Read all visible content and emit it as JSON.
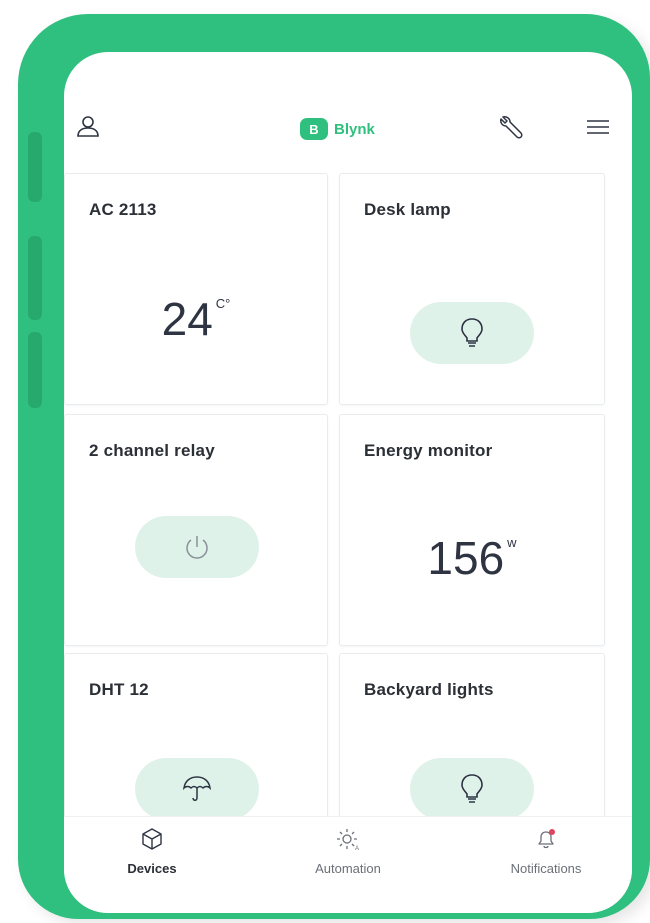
{
  "header": {
    "brand_letter": "B",
    "brand_name": "Blynk",
    "icons": {
      "profile": "user-icon",
      "settings": "wrench-icon",
      "menu": "hamburger-menu-icon"
    }
  },
  "devices": [
    {
      "title": "AC 2113",
      "value": "24",
      "unit": "C°"
    },
    {
      "title": "Desk lamp",
      "icon": "lightbulb-icon"
    },
    {
      "title": "2 channel relay",
      "icon": "power-icon"
    },
    {
      "title": "Energy monitor",
      "value": "156",
      "unit": "w"
    },
    {
      "title": "DHT 12",
      "icon": "umbrella-icon"
    },
    {
      "title": "Backyard lights",
      "icon": "lightbulb-icon"
    }
  ],
  "nav": [
    {
      "label": "Devices",
      "icon": "cube-icon",
      "active": true
    },
    {
      "label": "Automation",
      "icon": "sun-automation-icon",
      "active": false
    },
    {
      "label": "Notifications",
      "icon": "bell-icon",
      "active": false
    }
  ],
  "colors": {
    "brand": "#2fbf7e",
    "pill": "#dff2e9",
    "notification_dot": "#e2435c"
  }
}
